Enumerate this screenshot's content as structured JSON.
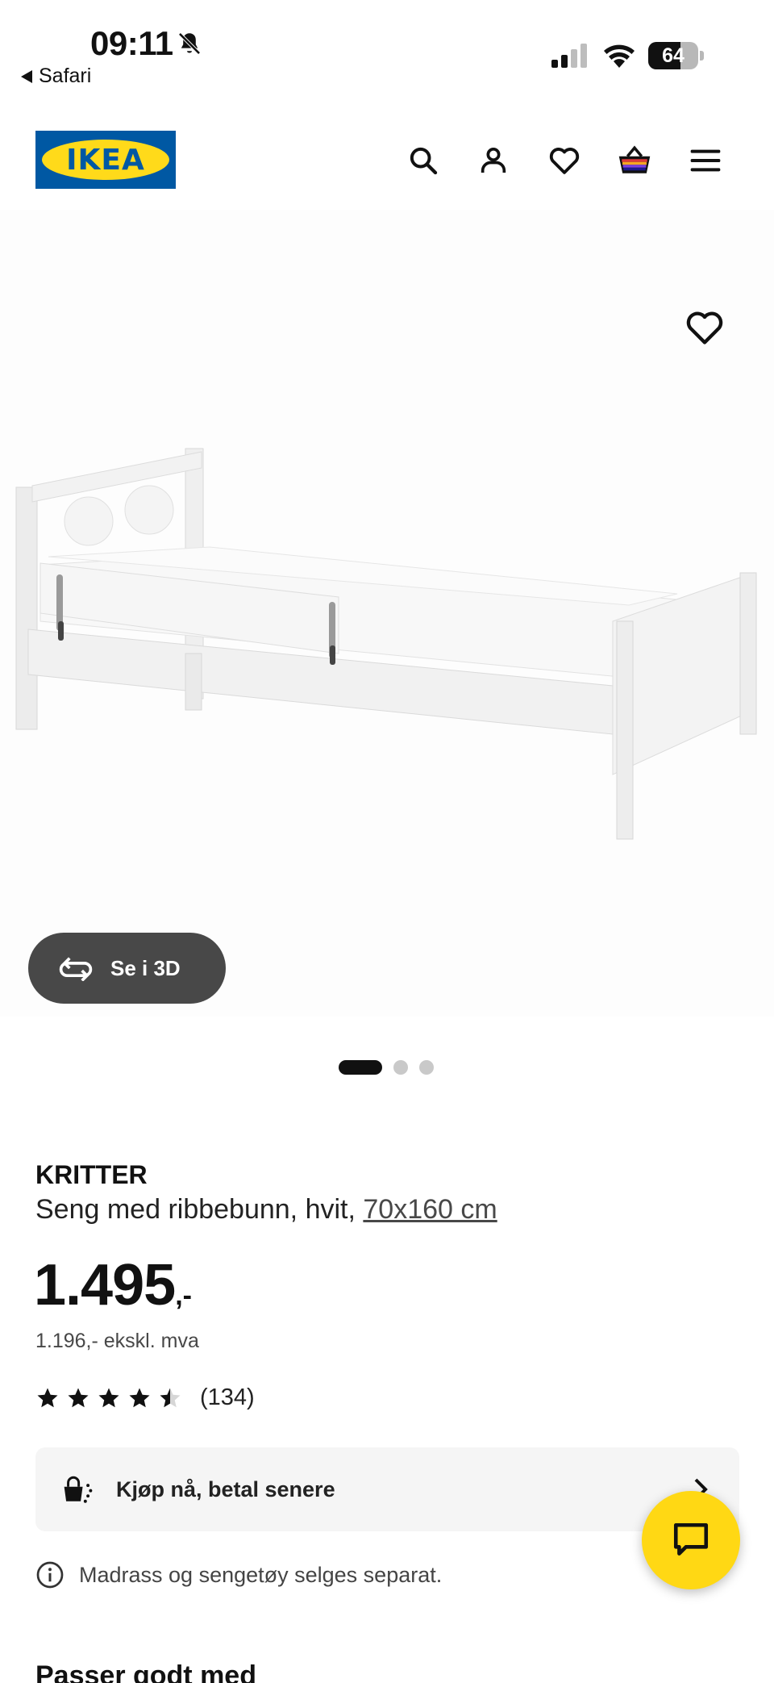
{
  "status_bar": {
    "time": "09:11",
    "back_app": "Safari",
    "battery_level": "64",
    "battery_fraction": 0.64,
    "icons": [
      "bell-slash-icon",
      "cellular-signal-icon",
      "wifi-icon",
      "battery-icon"
    ]
  },
  "header": {
    "logo_text": "IKEA",
    "icons": [
      "search-icon",
      "account-icon",
      "heart-icon",
      "basket-icon",
      "menu-icon"
    ],
    "colors": {
      "logo_blue": "#0058a3",
      "logo_yellow": "#ffda1a"
    }
  },
  "gallery": {
    "view_3d_label": "Se i 3D",
    "slide_count": 3,
    "active_slide": 1
  },
  "product": {
    "name": "KRITTER",
    "description": "Seng med ribbebunn, hvit, ",
    "size": "70x160 cm",
    "price_main": "1.495",
    "price_suffix": ",-",
    "price_ex_vat": "1.196,- ekskl. mva",
    "rating_value": 4.5,
    "rating_max": 5,
    "rating_count": "(134)"
  },
  "bnpl": {
    "label": "Kjøp nå, betal senere"
  },
  "note": {
    "text": "Madrass og sengetøy selges separat."
  },
  "section": {
    "title": "Passer godt med"
  },
  "chat": {
    "color": "#ffd814"
  }
}
